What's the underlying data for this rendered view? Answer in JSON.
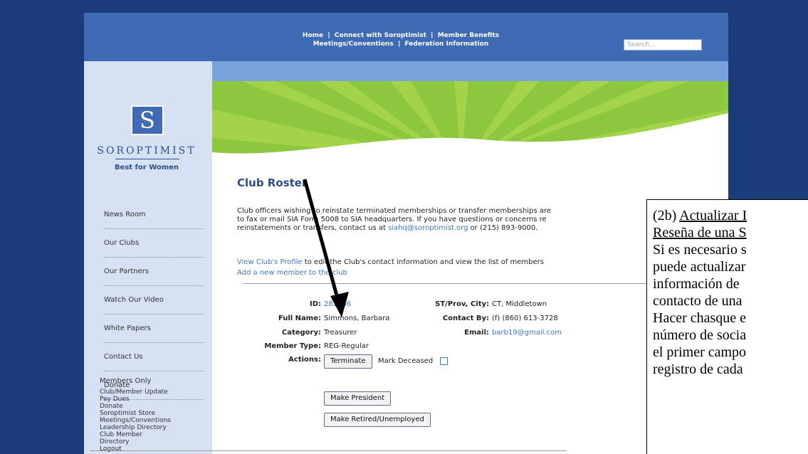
{
  "header": {
    "nav_line1": "Home  |  Connect with Soroptimist  |  Member Benefits",
    "nav_line2": "Meetings/Conventions  |  Federation Information",
    "search_placeholder": "Search..."
  },
  "logo": {
    "mark": "S",
    "name": "SOROPTIMIST",
    "tagline": "Best for Women"
  },
  "sidebar": {
    "items": [
      {
        "label": "News Room"
      },
      {
        "label": "Our Clubs"
      },
      {
        "label": "Our Partners"
      },
      {
        "label": "Watch Our Video"
      },
      {
        "label": "White Papers"
      },
      {
        "label": "Contact Us"
      },
      {
        "label": "Donate"
      }
    ],
    "members_title": "Members Only",
    "members_links": [
      "Club/Member Update",
      "Pay Dues",
      "Donate",
      "Soroptimist Store",
      "Meetings/Conventions",
      "Leadership Directory",
      "Club Member",
      "Directory",
      "Logout"
    ]
  },
  "main": {
    "title": "Club Roster",
    "intro_line1": "Club officers wishing to reinstate terminated memberships or transfer memberships are",
    "intro_line2": "to fax or mail SIA Form 5008 to SIA headquarters. If you have questions or concerns re",
    "intro_line3a": "reinstatements or transfers, contact us at ",
    "intro_email": "siahq@soroptimist.org",
    "intro_line3b": " or (215) 893-9000.",
    "profile_link": "View Club's Profile",
    "profile_text": " to edit the Club's contact information and view the list of members",
    "add_member_link": "Add a new member to the club"
  },
  "member": {
    "id_label": "ID:",
    "id_value": "282286",
    "full_name_label": "Full Name:",
    "full_name_value": "Simmons, Barbara",
    "category_label": "Category:",
    "category_value": "Treasurer",
    "member_type_label": "Member Type:",
    "member_type_value": "REG-Regular",
    "actions_label": "Actions:",
    "st_city_label": "ST/Prov, City:",
    "st_city_value": "CT, Middletown",
    "contact_label": "Contact By:",
    "contact_value": "(f) (860) 613-3728",
    "email_label": "Email:",
    "email_value": "barb19@gmail.com"
  },
  "actions": {
    "terminate": "Terminate",
    "mark_deceased": "Mark Deceased",
    "make_president": "Make President",
    "make_retired": "Make Retired/Unemployed"
  },
  "overlay": {
    "line1_prefix": "(2b) ",
    "line1_underlined": "Actualizar I",
    "line2_underlined": "Reseña de una S",
    "lines": [
      "Si es necesario s",
      "puede actualizar",
      "información de",
      "contacto de una",
      "Hacer chasque e",
      "número de socia",
      "el primer campo",
      "registro de cada"
    ]
  },
  "colors": {
    "page_bg": "#1b3b7a",
    "header_blue": "#3f6bb5",
    "sidebar_bg": "#d6e1f3",
    "banner_green": "#8dc63f",
    "link_blue": "#3b78c8",
    "title_blue": "#2d4e8c"
  }
}
